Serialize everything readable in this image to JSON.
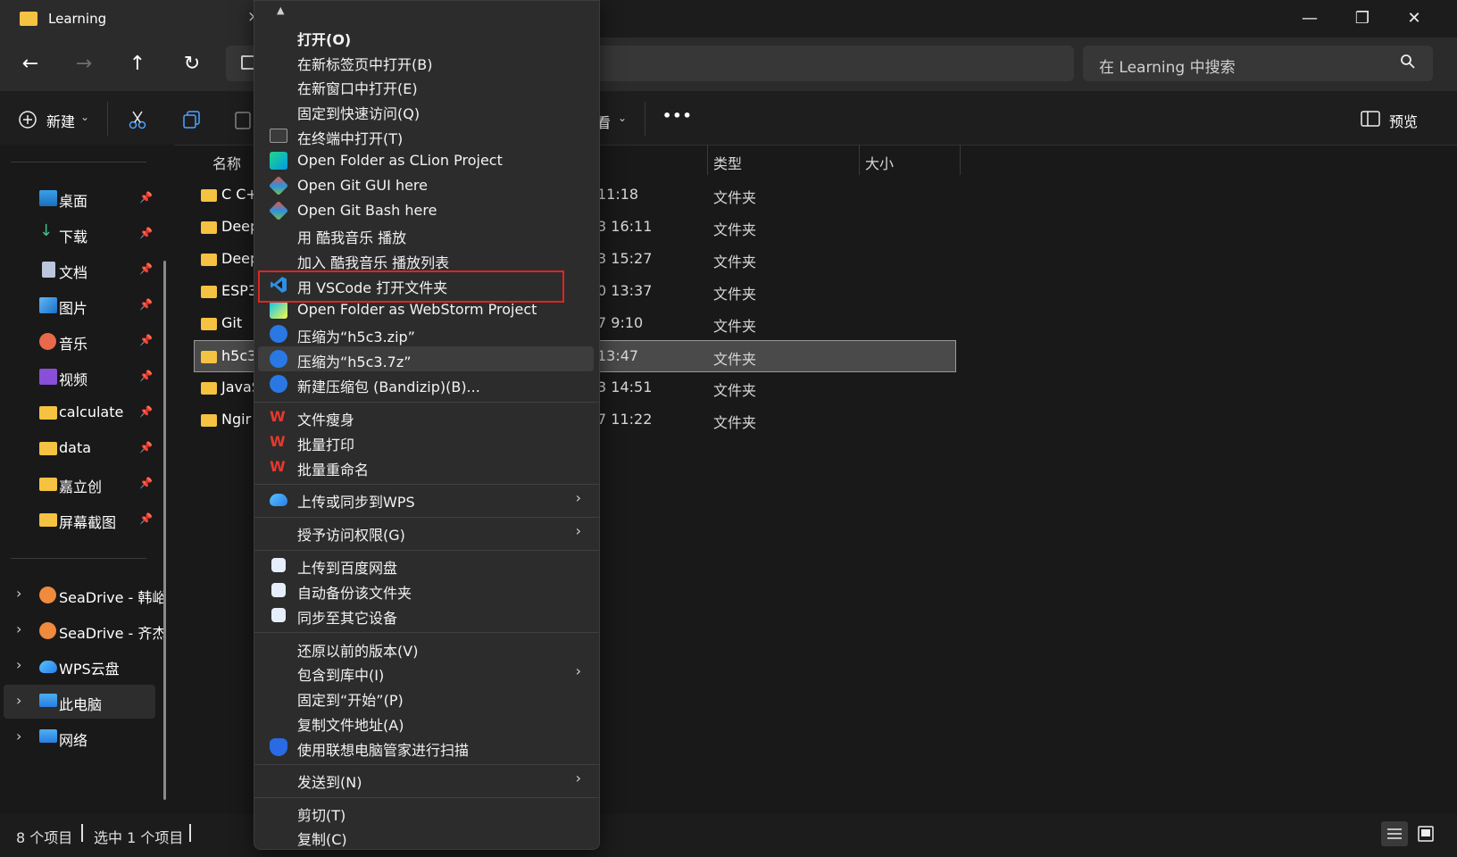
{
  "window": {
    "tab_title": "Learning",
    "tab_close": "×",
    "minimize": "—",
    "restore": "❐",
    "close": "✕"
  },
  "nav": {
    "back": "←",
    "forward": "→",
    "up": "↑",
    "refresh": "↻"
  },
  "search": {
    "placeholder": "在 Learning 中搜索"
  },
  "toolbar": {
    "new_label": "新建",
    "view_label_partial": "看",
    "more": "•••",
    "preview_label": "预览"
  },
  "sidebar": {
    "pinned": [
      {
        "label": "桌面",
        "icon": "desktop-icon"
      },
      {
        "label": "下载",
        "icon": "download-icon"
      },
      {
        "label": "文档",
        "icon": "document-icon"
      },
      {
        "label": "图片",
        "icon": "pictures-icon"
      },
      {
        "label": "音乐",
        "icon": "music-icon"
      },
      {
        "label": "视频",
        "icon": "video-icon"
      },
      {
        "label": "calculate",
        "icon": "folder-icon"
      },
      {
        "label": "data",
        "icon": "folder-icon"
      },
      {
        "label": "嘉立创",
        "icon": "folder-icon"
      },
      {
        "label": "屏幕截图",
        "icon": "folder-icon"
      }
    ],
    "drives": [
      {
        "label": "SeaDrive - 韩峪"
      },
      {
        "label": "SeaDrive - 齐杰"
      },
      {
        "label": "WPS云盘"
      },
      {
        "label": "此电脑"
      },
      {
        "label": "网络"
      }
    ]
  },
  "columns": {
    "name": "名称",
    "type": "类型",
    "size": "大小"
  },
  "files": [
    {
      "name": "C C+",
      "date": "11:18",
      "type": "文件夹"
    },
    {
      "name": "Deep",
      "date": "3 16:11",
      "type": "文件夹"
    },
    {
      "name": "Deep",
      "date": "3 15:27",
      "type": "文件夹"
    },
    {
      "name": "ESP3",
      "date": "0 13:37",
      "type": "文件夹"
    },
    {
      "name": "Git",
      "date": "7 9:10",
      "type": "文件夹"
    },
    {
      "name": "h5c3",
      "date": "13:47",
      "type": "文件夹"
    },
    {
      "name": "JavaS",
      "date": "3 14:51",
      "type": "文件夹"
    },
    {
      "name": "Ngir",
      "date": "7 11:22",
      "type": "文件夹"
    }
  ],
  "status": {
    "item_count": "8 个项目",
    "selected": "选中 1 个项目"
  },
  "context_menu": {
    "top_arrow": "▲",
    "items": [
      {
        "label": "打开(O)"
      },
      {
        "label": "在新标签页中打开(B)"
      },
      {
        "label": "在新窗口中打开(E)"
      },
      {
        "label": "固定到快速访问(Q)"
      },
      {
        "label": "在终端中打开(T)"
      },
      {
        "label": "Open Folder as CLion Project"
      },
      {
        "label": "Open Git GUI here"
      },
      {
        "label": "Open Git Bash here"
      },
      {
        "label": "用 酷我音乐 播放"
      },
      {
        "label": "加入 酷我音乐 播放列表"
      },
      {
        "label": "用 VSCode 打开文件夹"
      },
      {
        "label": "Open Folder as WebStorm Project"
      },
      {
        "label": "压缩为“h5c3.zip”"
      },
      {
        "label": "压缩为“h5c3.7z”"
      },
      {
        "label": "新建压缩包 (Bandizip)(B)..."
      },
      {
        "label": "文件瘦身"
      },
      {
        "label": "批量打印"
      },
      {
        "label": "批量重命名"
      },
      {
        "label": "上传或同步到WPS"
      },
      {
        "label": "授予访问权限(G)"
      },
      {
        "label": "上传到百度网盘"
      },
      {
        "label": "自动备份该文件夹"
      },
      {
        "label": "同步至其它设备"
      },
      {
        "label": "还原以前的版本(V)"
      },
      {
        "label": "包含到库中(I)"
      },
      {
        "label": "固定到“开始”(P)"
      },
      {
        "label": "复制文件地址(A)"
      },
      {
        "label": "使用联想电脑管家进行扫描"
      },
      {
        "label": "发送到(N)"
      },
      {
        "label": "剪切(T)"
      },
      {
        "label": "复制(C)"
      }
    ],
    "submenu_arrow": "›"
  },
  "colors": {
    "highlight_box": "#e02424",
    "folder": "#f5c242",
    "vscode": "#2f8fe0",
    "wps_red": "#e8382e",
    "bandizip_blue": "#2a78e4"
  }
}
